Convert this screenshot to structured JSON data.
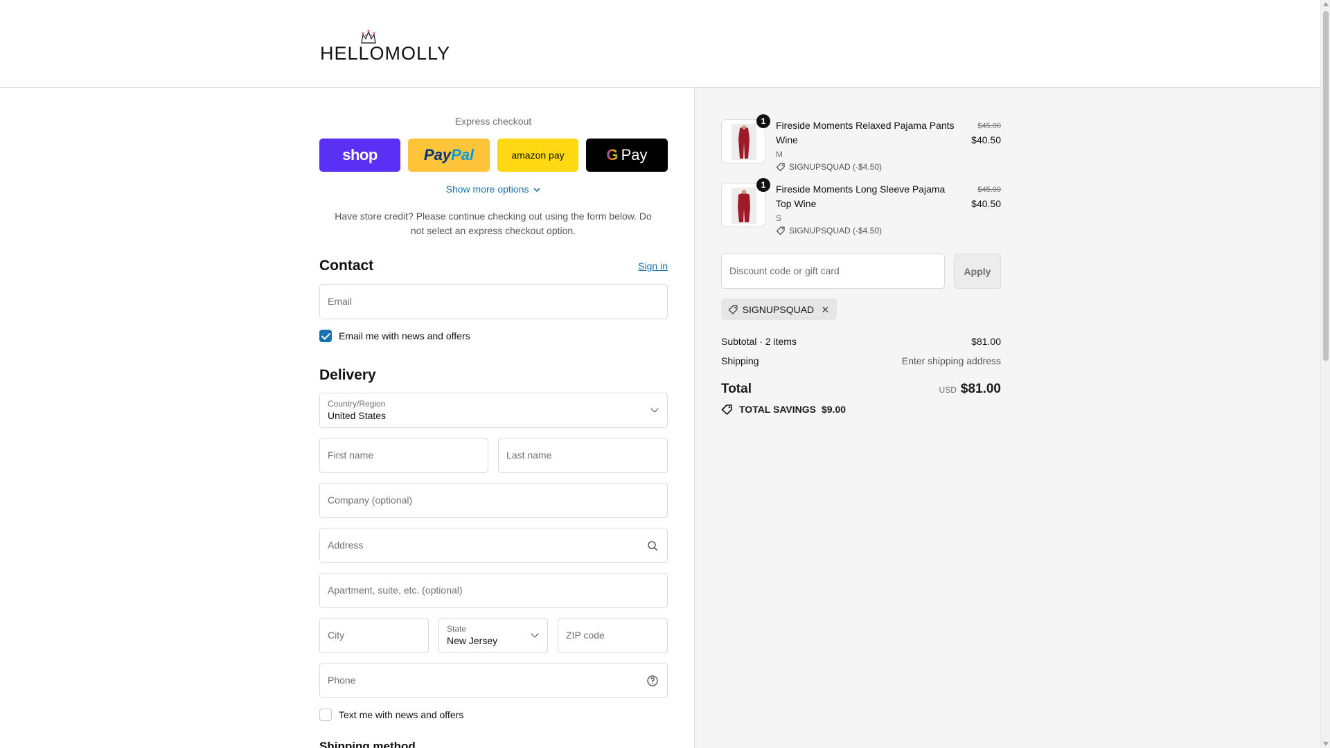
{
  "brand": {
    "logo_text": "HELLOMOLLY"
  },
  "express": {
    "title": "Express checkout",
    "buttons": {
      "shop": "shop",
      "paypal_a": "Pay",
      "paypal_b": "Pal",
      "amazon": "amazon pay",
      "gpay_g": "G",
      "gpay": "Pay"
    },
    "more_options": "Show more options",
    "store_credit": "Have store credit? Please continue checking out using the form below. Do not select an express checkout option."
  },
  "contact": {
    "title": "Contact",
    "sign_in": "Sign in",
    "email_placeholder": "Email",
    "news_label": "Email me with news and offers",
    "news_checked": true
  },
  "delivery": {
    "title": "Delivery",
    "country_label": "Country/Region",
    "country_value": "United States",
    "first_name": "First name",
    "last_name": "Last name",
    "company": "Company (optional)",
    "address": "Address",
    "apartment": "Apartment, suite, etc. (optional)",
    "city": "City",
    "state_label": "State",
    "state_value": "New Jersey",
    "zip": "ZIP code",
    "phone": "Phone",
    "text_label": "Text me with news and offers",
    "text_checked": false
  },
  "shipping_method": {
    "title": "Shipping method"
  },
  "order": {
    "items": [
      {
        "qty": "1",
        "name": "Fireside Moments Relaxed Pajama Pants Wine",
        "variant": "M",
        "discount": "SIGNUPSQUAD (-$4.50)",
        "price_old": "$45.00",
        "price_new": "$40.50"
      },
      {
        "qty": "1",
        "name": "Fireside Moments Long Sleeve Pajama Top Wine",
        "variant": "S",
        "discount": "SIGNUPSQUAD (-$4.50)",
        "price_old": "$45.00",
        "price_new": "$40.50"
      }
    ],
    "discount_placeholder": "Discount code or gift card",
    "apply": "Apply",
    "applied_code": "SIGNUPSQUAD",
    "subtotal_label": "Subtotal · 2 items",
    "subtotal_value": "$81.00",
    "shipping_label": "Shipping",
    "shipping_value": "Enter shipping address",
    "total_label": "Total",
    "currency": "USD",
    "total_value": "$81.00",
    "savings_label": "TOTAL SAVINGS",
    "savings_value": "$9.00"
  },
  "colors": {
    "accent": "#1773b0",
    "shop": "#5a31f4",
    "paypal": "#ffc439",
    "amazon": "#ffd814",
    "gpay": "#000000",
    "summary_bg": "#f5f5f5"
  }
}
